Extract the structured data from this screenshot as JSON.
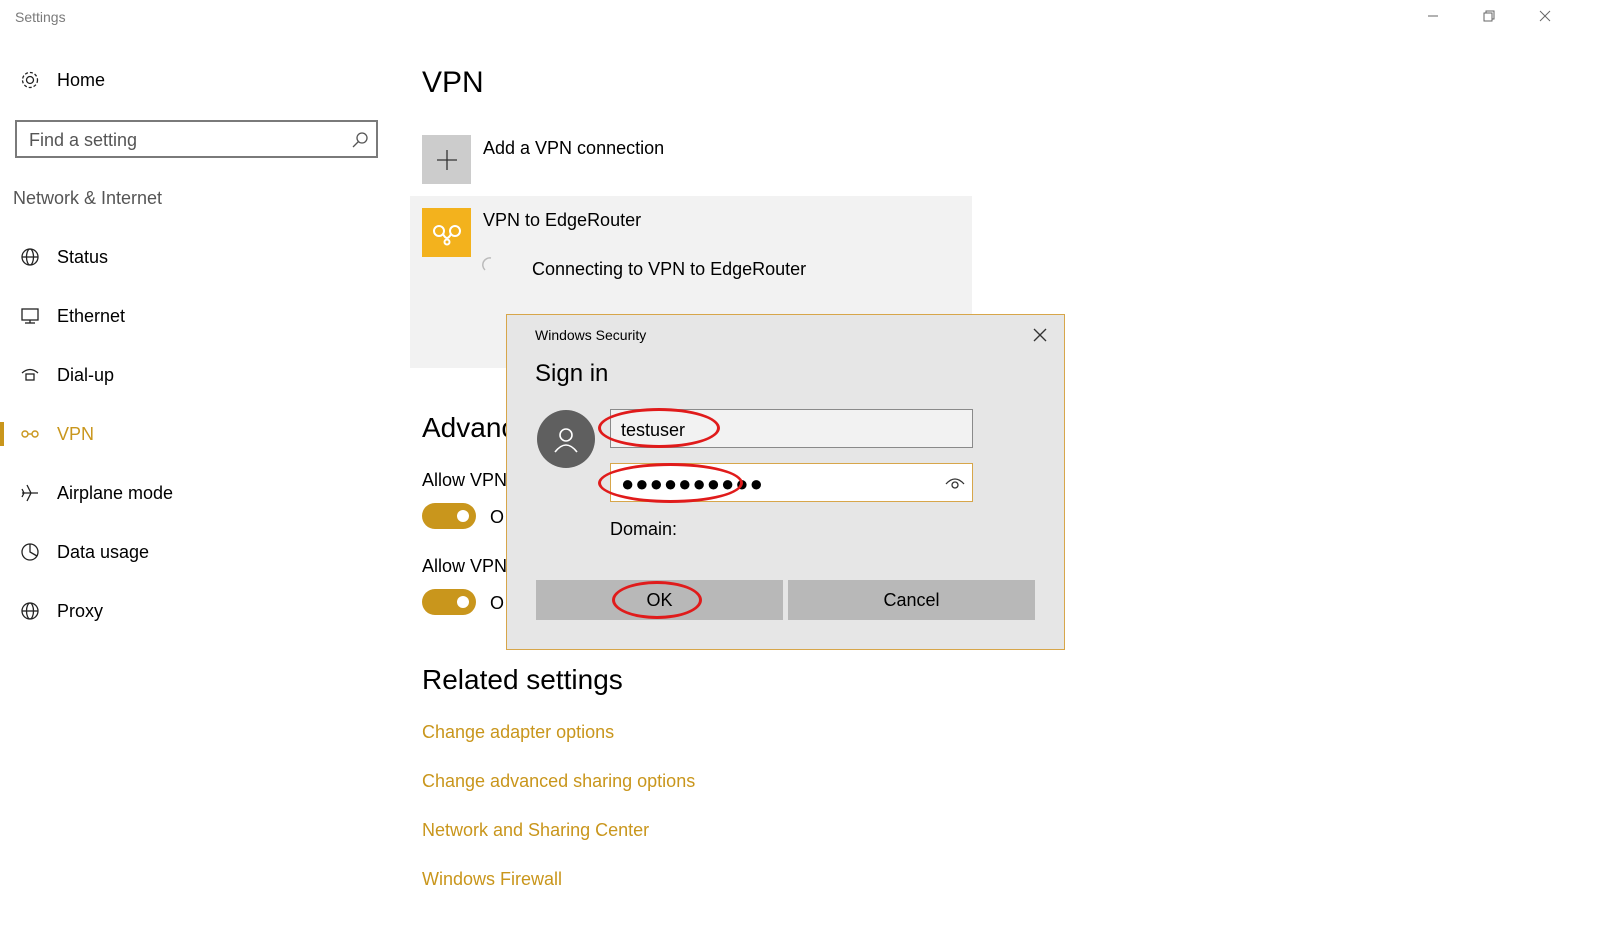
{
  "window": {
    "title": "Settings"
  },
  "sidebar": {
    "home_label": "Home",
    "search_placeholder": "Find a setting",
    "section_label": "Network & Internet",
    "items": [
      {
        "label": "Status",
        "icon": "globe-icon"
      },
      {
        "label": "Ethernet",
        "icon": "monitor-icon"
      },
      {
        "label": "Dial-up",
        "icon": "dialup-icon"
      },
      {
        "label": "VPN",
        "icon": "vpn-icon",
        "active": true
      },
      {
        "label": "Airplane mode",
        "icon": "airplane-icon"
      },
      {
        "label": "Data usage",
        "icon": "data-usage-icon"
      },
      {
        "label": "Proxy",
        "icon": "globe-icon"
      }
    ]
  },
  "main": {
    "title": "VPN",
    "add_vpn_label": "Add a VPN connection",
    "vpn_connection": {
      "name": "VPN to EdgeRouter",
      "status": "Connecting to VPN to EdgeRouter"
    },
    "advanced_title": "Advanc",
    "advanced_settings": [
      {
        "label": "Allow VPN",
        "toggle_text": "O",
        "on": true
      },
      {
        "label": "Allow VPN",
        "toggle_text": "O",
        "on": true
      }
    ],
    "related_title": "Related settings",
    "related_links": [
      "Change adapter options",
      "Change advanced sharing options",
      "Network and Sharing Center",
      "Windows Firewall"
    ]
  },
  "dialog": {
    "caption": "Windows Security",
    "title": "Sign in",
    "username": "testuser",
    "password_mask": "●●●●●●●●●●",
    "domain_label": "Domain:",
    "ok_label": "OK",
    "cancel_label": "Cancel"
  },
  "colors": {
    "accent": "#c9961c",
    "vpn_tile": "#f3b21d",
    "highlight_ring": "#e01b1b"
  }
}
